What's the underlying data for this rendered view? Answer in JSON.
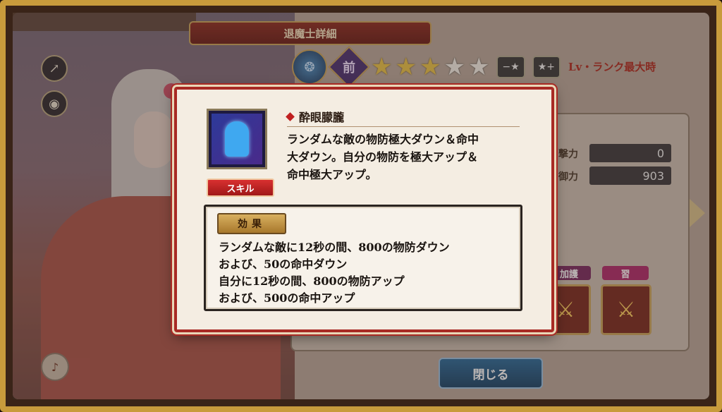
{
  "header": {
    "topbar_text": "",
    "screen_title": "退魔士詳細"
  },
  "character": {
    "stars_filled": 3,
    "stars_total": 6,
    "class_glyph": "前",
    "btn_star_minus": "−★",
    "btn_star_plus": "★+",
    "lv_note": "Lv・ランク最大時"
  },
  "stats": {
    "atk_label": "撃力",
    "atk_value": "0",
    "def_label": "御力",
    "def_value": "903"
  },
  "slots": {
    "tag1": "加護",
    "tag2": "習"
  },
  "close_button": "閉じる",
  "popup": {
    "skill_name": "酔眼朦朧",
    "badge": "スキル",
    "description": [
      "ランダムな敵の物防極大ダウン＆命中",
      "大ダウン。自分の物防を極大アップ＆",
      "命中極大アップ。"
    ],
    "effect_tag": "効果",
    "effect_lines": [
      "ランダムな敵に12秒の間、800の物防ダウン",
      "および、50の命中ダウン",
      "自分に12秒の間、800の物防アップ",
      "および、500の命中アップ"
    ]
  },
  "colors": {
    "accent_red": "#a82a24",
    "gold": "#c9a35a",
    "star_gold": "#e8c248"
  },
  "icons": [
    "share-icon",
    "camera-icon",
    "sound-icon",
    "next-arrow-icon",
    "sword-icon"
  ]
}
